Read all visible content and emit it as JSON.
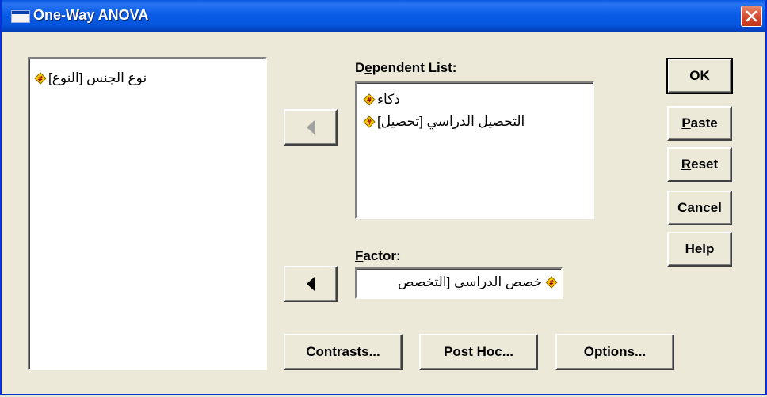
{
  "window": {
    "title": "One-Way ANOVA"
  },
  "source_list": {
    "items": [
      {
        "label": "[نوع الجنس [النوع"
      }
    ]
  },
  "dependent_list": {
    "label_pre": "D",
    "label_underline": "e",
    "label_post": "pendent List:",
    "items": [
      {
        "label": "ذكاء"
      },
      {
        "label": "[التحصيل الدراسي [تحصيل"
      }
    ]
  },
  "factor": {
    "label_underline": "F",
    "label_post": "actor:",
    "value": "خصص الدراسي [التخصص"
  },
  "buttons": {
    "ok": "OK",
    "paste_u": "P",
    "paste_rest": "aste",
    "reset_u": "R",
    "reset_rest": "eset",
    "cancel": "Cancel",
    "help": "Help",
    "contrasts_u": "C",
    "contrasts_rest": "ontrasts...",
    "posthoc_pre": "Post ",
    "posthoc_u": "H",
    "posthoc_rest": "oc...",
    "options_u": "O",
    "options_rest": "ptions..."
  },
  "icons": {
    "variable": "scale-variable-icon",
    "move_dependent": "left-arrow-icon",
    "move_factor": "left-arrow-icon",
    "close": "close-icon"
  },
  "colors": {
    "titlebar": "#0a5de8",
    "dialog": "#ece9d8",
    "close": "#d6492b"
  }
}
